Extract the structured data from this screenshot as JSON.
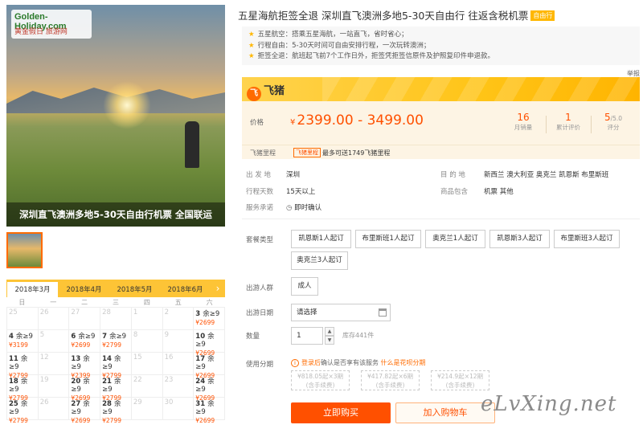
{
  "left": {
    "logo_en": "Golden-Holiday.com",
    "logo_cn": "黄金假日 旅游网",
    "caption": "深圳直飞澳洲多地5-30天自由行机票  全国联运"
  },
  "calendar": {
    "months": [
      "2018年3月",
      "2018年4月",
      "2018年5月",
      "2018年6月"
    ],
    "next_arrow": "›",
    "weekdays": [
      "日",
      "一",
      "二",
      "三",
      "四",
      "五",
      "六"
    ],
    "cells": [
      {
        "d": "25",
        "dim": true
      },
      {
        "d": "26",
        "dim": true
      },
      {
        "d": "27",
        "dim": true
      },
      {
        "d": "28",
        "dim": true
      },
      {
        "d": "1",
        "dim": true
      },
      {
        "d": "2",
        "dim": true
      },
      {
        "d": "3",
        "s": "余≥9",
        "p": "¥2699"
      },
      {
        "d": "4",
        "s": "余≥9",
        "p": "¥3199"
      },
      {
        "d": "5",
        "dim": true
      },
      {
        "d": "6",
        "s": "余≥9",
        "p": "¥2699"
      },
      {
        "d": "7",
        "s": "余≥9",
        "p": "¥2799"
      },
      {
        "d": "8",
        "dim": true
      },
      {
        "d": "9",
        "dim": true
      },
      {
        "d": "10",
        "s": "余≥9",
        "p": "¥2699"
      },
      {
        "d": "11",
        "s": "余≥9",
        "p": "¥2799"
      },
      {
        "d": "12",
        "dim": true
      },
      {
        "d": "13",
        "s": "余≥9",
        "p": "¥2399"
      },
      {
        "d": "14",
        "s": "余≥9",
        "p": "¥2799"
      },
      {
        "d": "15",
        "dim": true
      },
      {
        "d": "16",
        "dim": true
      },
      {
        "d": "17",
        "s": "余≥9",
        "p": "¥2699"
      },
      {
        "d": "18",
        "s": "余≥9",
        "p": "¥2799"
      },
      {
        "d": "19",
        "dim": true
      },
      {
        "d": "20",
        "s": "余≥9",
        "p": "¥2699"
      },
      {
        "d": "21",
        "s": "余≥9",
        "p": "¥2799"
      },
      {
        "d": "22",
        "dim": true
      },
      {
        "d": "23",
        "dim": true
      },
      {
        "d": "24",
        "s": "余≥9",
        "p": "¥2699"
      },
      {
        "d": "25",
        "s": "余≥9",
        "p": "¥2799"
      },
      {
        "d": "26",
        "dim": true
      },
      {
        "d": "27",
        "s": "余≥9",
        "p": "¥2699"
      },
      {
        "d": "28",
        "s": "余≥9",
        "p": "¥2799"
      },
      {
        "d": "29",
        "dim": true
      },
      {
        "d": "30",
        "dim": true
      },
      {
        "d": "31",
        "s": "余≥9",
        "p": "¥2699"
      }
    ]
  },
  "title": "五星海航拒签全退 深圳直飞澳洲多地5-30天自由行 往返含税机票",
  "title_tag": "自由行",
  "features": [
    "五星航空：搭乘五星海航，一站直飞，省时省心；",
    "行程自由：5-30天时间可自由安排行程，一次玩转澳洲；",
    "拒签全退：航班起飞前7个工作日外，拒签凭拒签信原件及护照复印件申退款。"
  ],
  "report": "举报",
  "brand": {
    "icon": "飞",
    "name": "飞猪"
  },
  "price": {
    "label": "价格",
    "currency": "¥",
    "range": "2399.00 - 3499.00",
    "sales": "16",
    "sales_label": "月销量",
    "reviews": "1",
    "reviews_label": "累计评价",
    "rating": "5",
    "rating_of": "/5.0",
    "rating_label": "评分"
  },
  "miles": {
    "label": "飞猪里程",
    "badge": "飞猪里程",
    "text": "最多可送1749飞猪里程"
  },
  "info": {
    "depart_k": "出 发 地",
    "depart_v": "深圳",
    "dest_k": "目 的 地",
    "dest_v": "新西兰  澳大利亚  奥克兰  凯恩斯  布里斯班",
    "days_k": "行程天数",
    "days_v": "15天以上",
    "include_k": "商品包含",
    "include_v": "机票  其他",
    "promise_k": "服务承诺",
    "promise_v": "即时确认"
  },
  "package": {
    "label": "套餐类型",
    "options": [
      "凯恩斯1人起订",
      "布里斯班1人起订",
      "奥克兰1人起订",
      "凯恩斯3人起订",
      "布里斯班3人起订",
      "奥克兰3人起订"
    ]
  },
  "crowd": {
    "label": "出游人群",
    "option": "成人"
  },
  "date": {
    "label": "出游日期",
    "value": "请选择"
  },
  "quantity": {
    "label": "数量",
    "value": "1",
    "up": "▲",
    "down": "▼",
    "stock": "库存441件"
  },
  "installment": {
    "label": "使用分期",
    "icon": "i",
    "login": "登录后",
    "text": "确认是否享有该服务",
    "link": "什么是花呗分期",
    "plans": [
      {
        "amt": "¥818.05起×3期",
        "fee": "(含手续费)"
      },
      {
        "amt": "¥417.82起×6期",
        "fee": "(含手续费)"
      },
      {
        "amt": "¥214.9起×12期",
        "fee": "(含手续费)"
      }
    ]
  },
  "actions": {
    "buy": "立即购买",
    "cart": "加入购物车"
  },
  "watermark": "eLvXing.net"
}
